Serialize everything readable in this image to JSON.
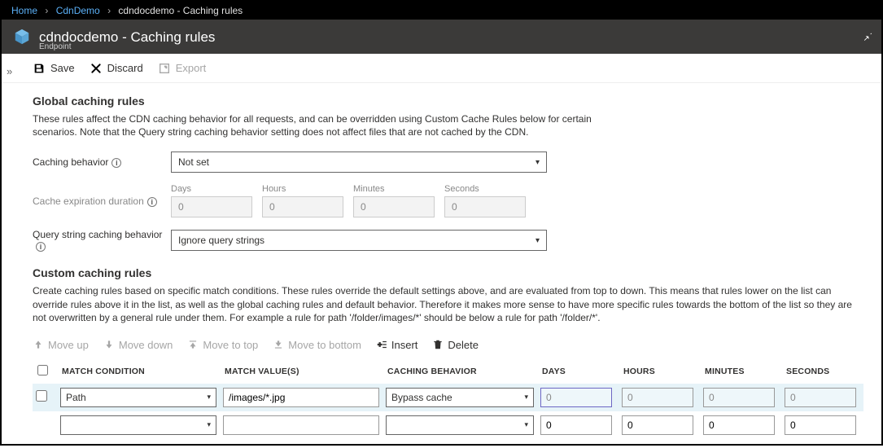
{
  "breadcrumb": {
    "items": [
      "Home",
      "CdnDemo",
      "cdndocdemo - Caching rules"
    ]
  },
  "header": {
    "title": "cdndocdemo - Caching rules",
    "subtitle": "Endpoint"
  },
  "toolbar": {
    "save": "Save",
    "discard": "Discard",
    "export": "Export"
  },
  "global": {
    "heading": "Global caching rules",
    "desc": "These rules affect the CDN caching behavior for all requests, and can be overridden using Custom Cache Rules below for certain scenarios. Note that the Query string caching behavior setting does not affect files that are not cached by the CDN.",
    "caching_behavior_label": "Caching behavior",
    "caching_behavior_value": "Not set",
    "expiration_label": "Cache expiration duration",
    "duration_labels": {
      "days": "Days",
      "hours": "Hours",
      "minutes": "Minutes",
      "seconds": "Seconds"
    },
    "duration_values": {
      "days": "0",
      "hours": "0",
      "minutes": "0",
      "seconds": "0"
    },
    "query_label": "Query string caching behavior",
    "query_value": "Ignore query strings"
  },
  "custom": {
    "heading": "Custom caching rules",
    "desc": "Create caching rules based on specific match conditions. These rules override the default settings above, and are evaluated from top to down. This means that rules lower on the list can override rules above it in the list, as well as the global caching rules and default behavior. Therefore it makes more sense to have more specific rules towards the bottom of the list so they are not overwritten by a general rule under them. For example a rule for path '/folder/images/*' should be below a rule for path '/folder/*'.",
    "toolbar": {
      "move_up": "Move up",
      "move_down": "Move down",
      "move_top": "Move to top",
      "move_bottom": "Move to bottom",
      "insert": "Insert",
      "delete": "Delete"
    },
    "columns": {
      "match_condition": "MATCH CONDITION",
      "match_values": "MATCH VALUE(S)",
      "caching_behavior": "CACHING BEHAVIOR",
      "days": "DAYS",
      "hours": "HOURS",
      "minutes": "MINUTES",
      "seconds": "SECONDS"
    },
    "rows": [
      {
        "selected": false,
        "highlighted": true,
        "match_condition": "Path",
        "match_value": "/images/*.jpg",
        "caching_behavior": "Bypass cache",
        "days": "0",
        "hours": "0",
        "minutes": "0",
        "seconds": "0",
        "duration_readonly": true
      },
      {
        "selected": false,
        "highlighted": false,
        "match_condition": "",
        "match_value": "",
        "caching_behavior": "",
        "days": "0",
        "hours": "0",
        "minutes": "0",
        "seconds": "0",
        "duration_readonly": false
      }
    ]
  }
}
